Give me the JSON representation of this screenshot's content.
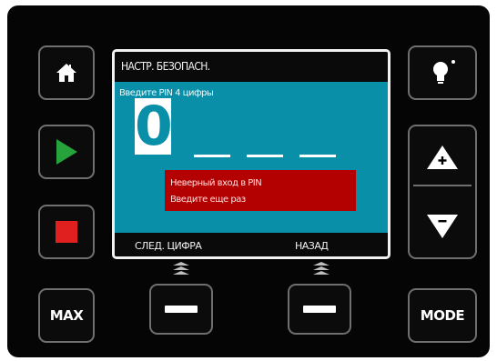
{
  "screen": {
    "title": "НАСТР. БЕЗОПАСН.",
    "prompt": "Введите PIN 4 цифры",
    "pin_digits": [
      "0",
      "",
      "",
      ""
    ],
    "error": {
      "line1": "Неверный вход в PIN",
      "line2": "Введите еще раз"
    },
    "softkeys": {
      "left": "СЛЕД. ЦИФРА",
      "right": "НАЗАД"
    }
  },
  "buttons": {
    "max_label": "MAX",
    "mode_label": "MODE"
  },
  "colors": {
    "screen_bg": "#0a8fa8",
    "start_green": "#27a33c",
    "stop_red": "#e0201f",
    "error_bg": "#b30000"
  },
  "icons": {
    "home": "home-icon",
    "play": "play-icon",
    "stop": "stop-icon",
    "light": "lightbulb-icon",
    "up": "arrow-up-plus-icon",
    "down": "arrow-down-minus-icon"
  }
}
